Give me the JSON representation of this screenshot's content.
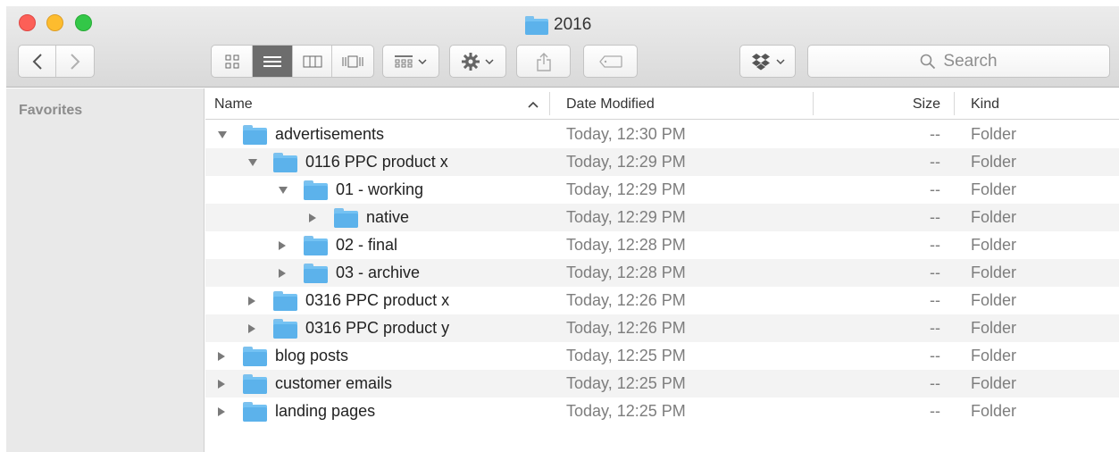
{
  "window": {
    "title": "2016",
    "colors": {
      "close": "#fc5f57",
      "minimize": "#fdbc2e",
      "maximize": "#33c748",
      "folder": "#5cb2eb"
    }
  },
  "toolbar": {
    "back_icon": "chevron-left-icon",
    "forward_icon": "chevron-right-icon",
    "view_modes": [
      {
        "icon": "icon-view-icon",
        "active": false
      },
      {
        "icon": "list-view-icon",
        "active": true
      },
      {
        "icon": "column-view-icon",
        "active": false
      },
      {
        "icon": "cover-flow-icon",
        "active": false
      }
    ],
    "arrange_icon": "arrange-grid-icon",
    "action_icon": "gear-icon",
    "share_icon": "share-icon",
    "tag_icon": "tag-icon",
    "dropbox_icon": "dropbox-icon",
    "search": {
      "placeholder": "Search"
    }
  },
  "sidebar": {
    "favorites_label": "Favorites"
  },
  "columns": {
    "name": "Name",
    "date": "Date Modified",
    "size": "Size",
    "kind": "Kind"
  },
  "rows": [
    {
      "name": "advertisements",
      "depth": 0,
      "expanded": true,
      "date": "Today, 12:30 PM",
      "size": "--",
      "kind": "Folder"
    },
    {
      "name": "0116 PPC product x",
      "depth": 1,
      "expanded": true,
      "date": "Today, 12:29 PM",
      "size": "--",
      "kind": "Folder"
    },
    {
      "name": "01 - working",
      "depth": 2,
      "expanded": true,
      "date": "Today, 12:29 PM",
      "size": "--",
      "kind": "Folder"
    },
    {
      "name": "native",
      "depth": 3,
      "expanded": false,
      "date": "Today, 12:29 PM",
      "size": "--",
      "kind": "Folder"
    },
    {
      "name": "02 - final",
      "depth": 2,
      "expanded": false,
      "date": "Today, 12:28 PM",
      "size": "--",
      "kind": "Folder"
    },
    {
      "name": "03 - archive",
      "depth": 2,
      "expanded": false,
      "date": "Today, 12:28 PM",
      "size": "--",
      "kind": "Folder"
    },
    {
      "name": "0316 PPC product x",
      "depth": 1,
      "expanded": false,
      "date": "Today, 12:26 PM",
      "size": "--",
      "kind": "Folder"
    },
    {
      "name": "0316 PPC product y",
      "depth": 1,
      "expanded": false,
      "date": "Today, 12:26 PM",
      "size": "--",
      "kind": "Folder"
    },
    {
      "name": "blog posts",
      "depth": 0,
      "expanded": false,
      "date": "Today, 12:25 PM",
      "size": "--",
      "kind": "Folder"
    },
    {
      "name": "customer emails",
      "depth": 0,
      "expanded": false,
      "date": "Today, 12:25 PM",
      "size": "--",
      "kind": "Folder"
    },
    {
      "name": "landing pages",
      "depth": 0,
      "expanded": false,
      "date": "Today, 12:25 PM",
      "size": "--",
      "kind": "Folder"
    }
  ]
}
